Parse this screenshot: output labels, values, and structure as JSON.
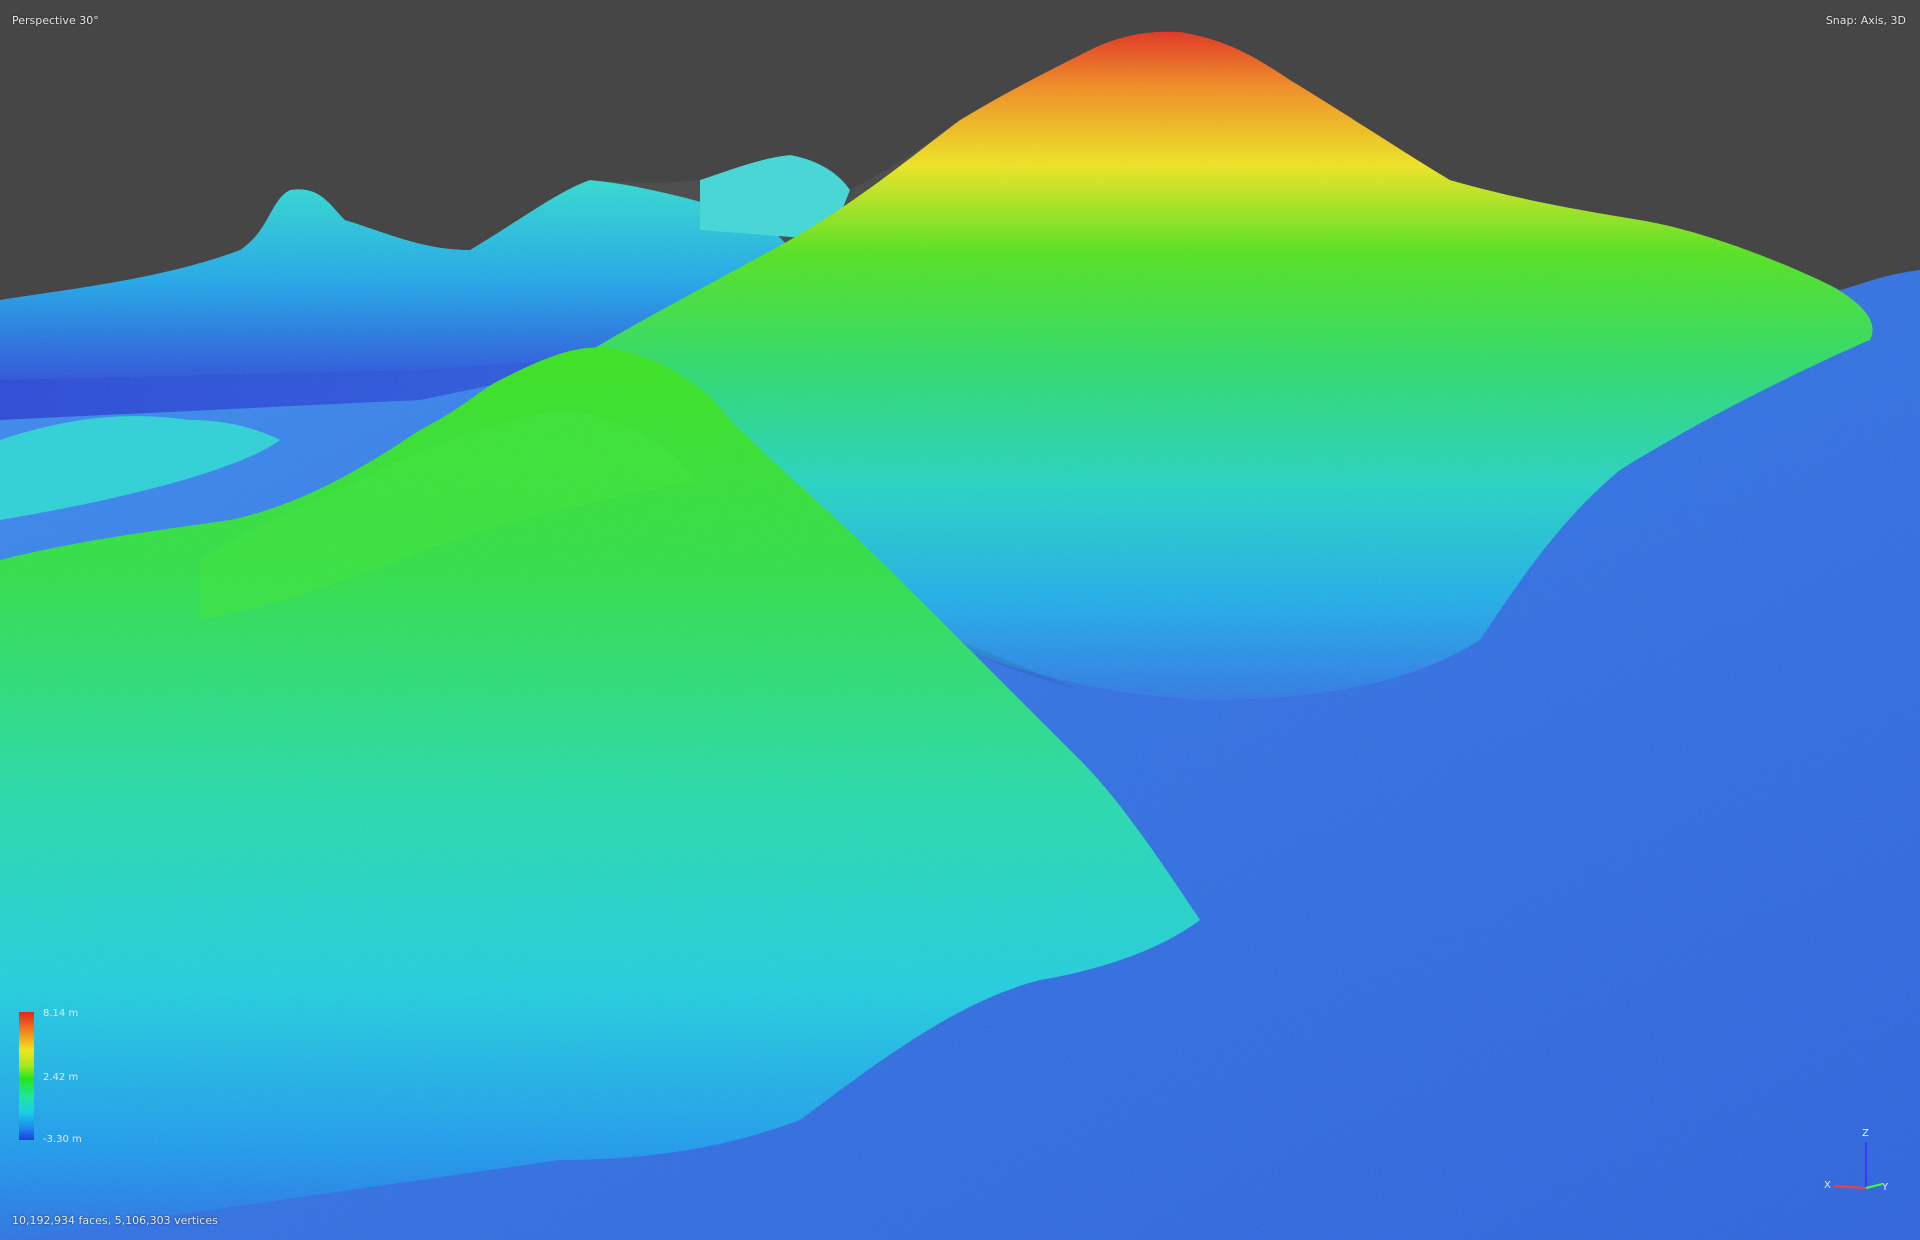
{
  "viewport": {
    "view_mode": "Perspective 30°",
    "snap_mode": "Snap: Axis, 3D",
    "stats": "10,192,934 faces, 5,106,303 vertices"
  },
  "legend": {
    "max_label": "8.14 m",
    "mid_label": "2.42 m",
    "min_label": "-3.30 m"
  },
  "axis_gizmo": {
    "z_label": "Z",
    "x_label": "X",
    "y_label": "Y"
  },
  "colors": {
    "background": "#464646",
    "seabed": "#2f78e6",
    "peak": "#e8241c",
    "mid": "#28e41c",
    "low": "#1ccfe0"
  }
}
